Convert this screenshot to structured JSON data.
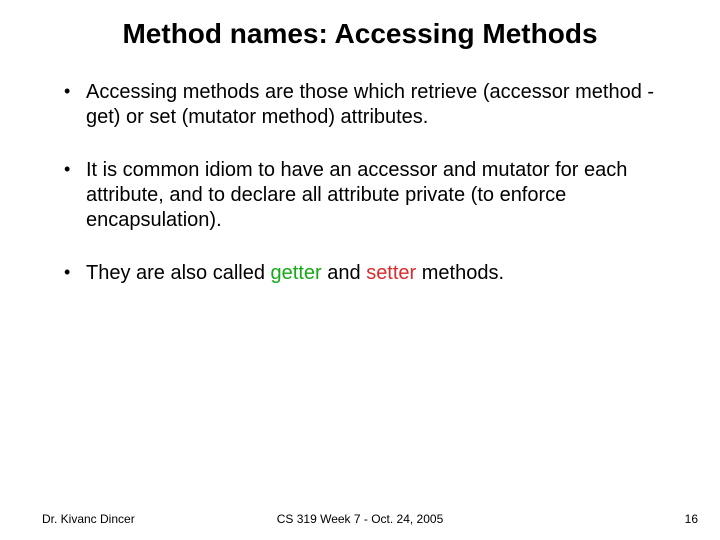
{
  "title": "Method names: Accessing Methods",
  "bullets": {
    "b1": "Accessing methods are those which retrieve (accessor method - get) or set (mutator method) attributes.",
    "b2": "It is common idiom to have an accessor and mutator for each attribute, and to declare all attribute private (to enforce encapsulation).",
    "b3_pre": "They are also called ",
    "b3_getter": "getter",
    "b3_and": " and ",
    "b3_setter": "setter",
    "b3_post": " methods."
  },
  "footer": {
    "left": "Dr. Kivanc Dincer",
    "center": "CS 319 Week 7 - Oct. 24, 2005",
    "right": "16"
  }
}
